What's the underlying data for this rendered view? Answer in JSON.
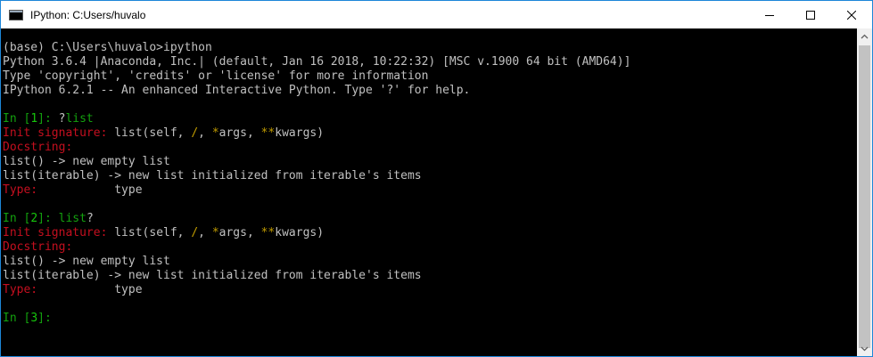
{
  "window": {
    "title": "IPython: C:Users/huvalo"
  },
  "console": {
    "header": [
      "(base) C:\\Users\\huvalo>ipython",
      "Python 3.6.4 |Anaconda, Inc.| (default, Jan 16 2018, 10:22:32) [MSC v.1900 64 bit (AMD64)]",
      "Type 'copyright', 'credits' or 'license' for more information",
      "IPython 6.2.1 -- An enhanced Interactive Python. Type '?' for help."
    ],
    "cells": [
      {
        "prompt_in": "In [",
        "prompt_num": "1",
        "prompt_close": "]: ",
        "input_pre": "?",
        "input_name": "list",
        "input_post": "",
        "sig_label": "Init signature:",
        "sig_a": " list(self, ",
        "sig_slash": "/",
        "sig_b": ", ",
        "sig_star": "*",
        "sig_c": "args, ",
        "sig_dstar": "**",
        "sig_d": "kwargs)",
        "doc_label": "Docstring:",
        "doc1": "list() -> new empty list",
        "doc2": "list(iterable) -> new list initialized from iterable's items",
        "type_label": "Type:",
        "type_value": "           type"
      },
      {
        "prompt_in": "In [",
        "prompt_num": "2",
        "prompt_close": "]: ",
        "input_pre": "",
        "input_name": "list",
        "input_post": "?",
        "sig_label": "Init signature:",
        "sig_a": " list(self, ",
        "sig_slash": "/",
        "sig_b": ", ",
        "sig_star": "*",
        "sig_c": "args, ",
        "sig_dstar": "**",
        "sig_d": "kwargs)",
        "doc_label": "Docstring:",
        "doc1": "list() -> new empty list",
        "doc2": "list(iterable) -> new list initialized from iterable's items",
        "type_label": "Type:",
        "type_value": "           type"
      }
    ],
    "final_prompt": {
      "prompt_in": "In [",
      "prompt_num": "3",
      "prompt_close": "]:"
    }
  },
  "icons": [
    "console-app-icon",
    "minimize-icon",
    "maximize-icon",
    "close-icon",
    "scroll-up-icon",
    "scroll-down-icon"
  ]
}
